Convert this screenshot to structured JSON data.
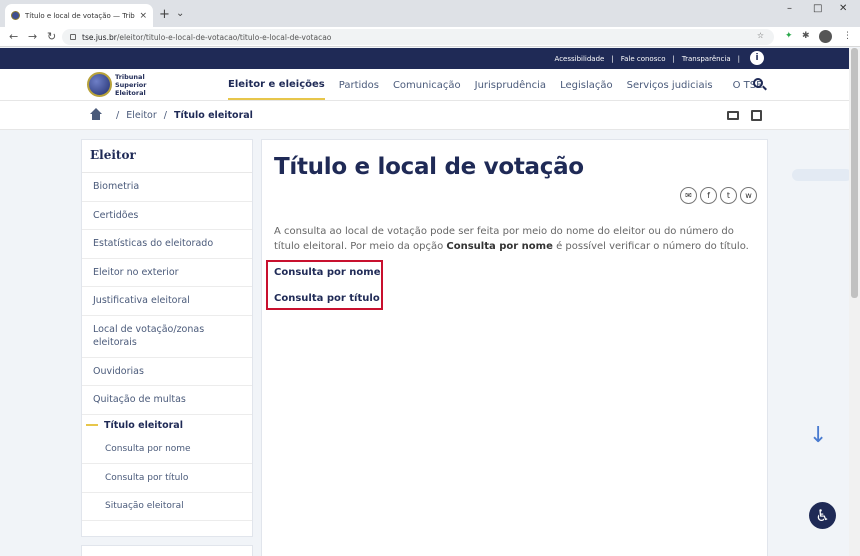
{
  "browser": {
    "tab_title": "Título e local de votação — Tribunal",
    "tab_close": "×",
    "new_tab": "+",
    "tab_list": "⌄",
    "win_min": "–",
    "win_max": "□",
    "win_close": "✕",
    "back": "←",
    "forward": "→",
    "reload": "↻",
    "url_host": "tse.jus.br",
    "url_path": "/eleitor/titulo-e-local-de-votacao/titulo-e-local-de-votacao",
    "star": "☆",
    "ext_puzzle": "✱",
    "menu": "⋮"
  },
  "topbar": {
    "links": [
      "Acessibilidade",
      "Fale conosco",
      "Transparência"
    ],
    "info": "i"
  },
  "logo": {
    "line1": "Tribunal",
    "line2": "Superior",
    "line3": "Eleitoral"
  },
  "nav": {
    "items": [
      "Eleitor e eleições",
      "Partidos",
      "Comunicação",
      "Jurisprudência",
      "Legislação",
      "Serviços judiciais",
      "O TSE"
    ]
  },
  "breadcrumb": {
    "sep": "/",
    "item1": "Eleitor",
    "current": "Título eleitoral"
  },
  "sidebar": {
    "title": "Eleitor",
    "items": [
      "Biometria",
      "Certidões",
      "Estatísticas do eleitorado",
      "Eleitor no exterior",
      "Justificativa eleitoral",
      "Local de votação/zonas eleitorais",
      "Ouvidorias",
      "Quitação de multas"
    ],
    "active": "Título eleitoral",
    "sub": [
      "Consulta por nome",
      "Consulta por título",
      "Situação eleitoral"
    ]
  },
  "main": {
    "title": "Título e local de votação",
    "share": [
      "✉",
      "f",
      "t",
      "w"
    ],
    "intro_1": "A consulta ao local de votação pode ser feita por meio do nome do eleitor ou do número do título eleitoral. Por meio da opção ",
    "intro_bold": "Consulta por nome",
    "intro_2": " é possível verificar o número do título.",
    "link_nome": "Consulta por nome",
    "link_titulo": "Consulta por título"
  },
  "floating": {
    "down": "↓",
    "a11y": "♿"
  }
}
